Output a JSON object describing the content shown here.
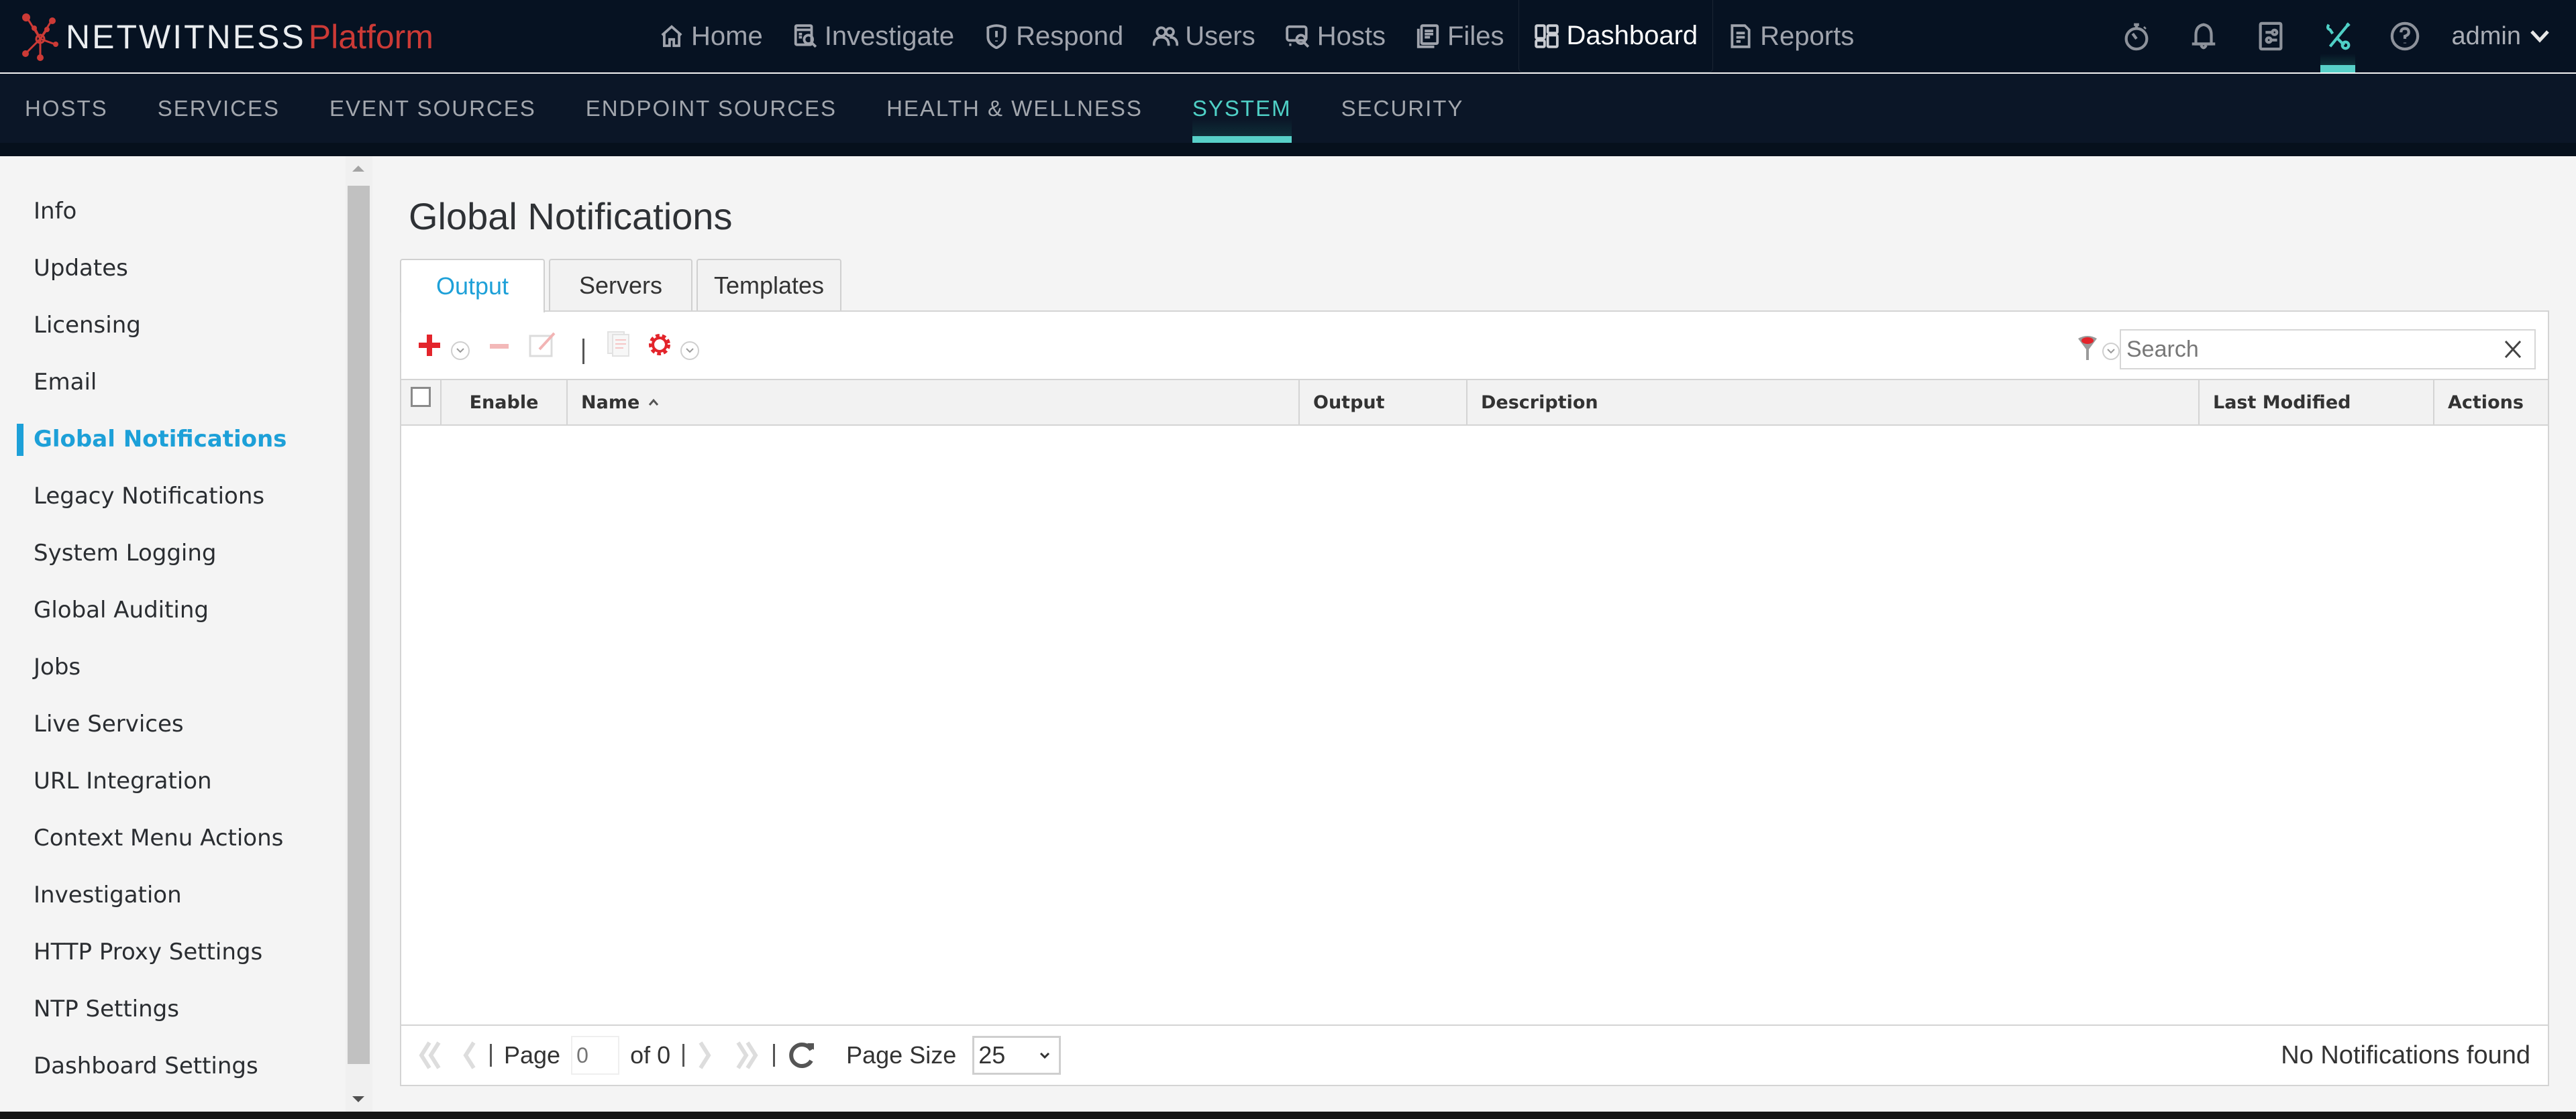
{
  "brand": {
    "name": "NETWITNESS",
    "product": "Platform"
  },
  "main_nav": [
    {
      "label": "Home",
      "icon": "home-icon",
      "active": false
    },
    {
      "label": "Investigate",
      "icon": "investigate-icon",
      "active": false
    },
    {
      "label": "Respond",
      "icon": "shield-alert-icon",
      "active": false
    },
    {
      "label": "Users",
      "icon": "users-icon",
      "active": false
    },
    {
      "label": "Hosts",
      "icon": "hosts-icon",
      "active": false
    },
    {
      "label": "Files",
      "icon": "files-icon",
      "active": false
    },
    {
      "label": "Dashboard",
      "icon": "dashboard-icon",
      "active": true
    },
    {
      "label": "Reports",
      "icon": "reports-icon",
      "active": false
    }
  ],
  "right_nav": {
    "icons": [
      "stopwatch-icon",
      "bell-icon",
      "settings-panel-icon",
      "admin-tools-icon",
      "help-icon"
    ],
    "active_icon": "admin-tools-icon",
    "user": "admin"
  },
  "sub_nav": [
    {
      "label": "HOSTS",
      "active": false
    },
    {
      "label": "SERVICES",
      "active": false
    },
    {
      "label": "EVENT SOURCES",
      "active": false
    },
    {
      "label": "ENDPOINT SOURCES",
      "active": false
    },
    {
      "label": "HEALTH & WELLNESS",
      "active": false
    },
    {
      "label": "SYSTEM",
      "active": true
    },
    {
      "label": "SECURITY",
      "active": false
    }
  ],
  "sidebar": {
    "items": [
      {
        "label": "Info",
        "active": false
      },
      {
        "label": "Updates",
        "active": false
      },
      {
        "label": "Licensing",
        "active": false
      },
      {
        "label": "Email",
        "active": false
      },
      {
        "label": "Global Notifications",
        "active": true
      },
      {
        "label": "Legacy Notifications",
        "active": false
      },
      {
        "label": "System Logging",
        "active": false
      },
      {
        "label": "Global Auditing",
        "active": false
      },
      {
        "label": "Jobs",
        "active": false
      },
      {
        "label": "Live Services",
        "active": false
      },
      {
        "label": "URL Integration",
        "active": false
      },
      {
        "label": "Context Menu Actions",
        "active": false
      },
      {
        "label": "Investigation",
        "active": false
      },
      {
        "label": "HTTP Proxy Settings",
        "active": false
      },
      {
        "label": "NTP Settings",
        "active": false
      },
      {
        "label": "Dashboard Settings",
        "active": false
      }
    ]
  },
  "page": {
    "title": "Global Notifications",
    "tabs": [
      {
        "label": "Output",
        "active": true
      },
      {
        "label": "Servers",
        "active": false
      },
      {
        "label": "Templates",
        "active": false
      }
    ]
  },
  "toolbar": {
    "buttons": [
      "add-icon",
      "remove-icon",
      "edit-icon",
      "clone-icon",
      "settings-gear-icon"
    ],
    "search_placeholder": "Search",
    "search_value": ""
  },
  "table": {
    "columns": [
      {
        "label": ""
      },
      {
        "label": "Enable"
      },
      {
        "label": "Name",
        "sort": "ascending"
      },
      {
        "label": "Output"
      },
      {
        "label": "Description"
      },
      {
        "label": "Last Modified"
      },
      {
        "label": "Actions"
      }
    ],
    "rows": []
  },
  "pager": {
    "page_label": "Page",
    "page_value": "0",
    "of_label": "of 0",
    "page_size_label": "Page Size",
    "page_size": "25",
    "status": "No Notifications found"
  },
  "colors": {
    "accent_blue": "#1da0d8",
    "accent_teal": "#4fd0c6",
    "brand_red": "#cc3a36",
    "topbar_bg": "#061222"
  }
}
